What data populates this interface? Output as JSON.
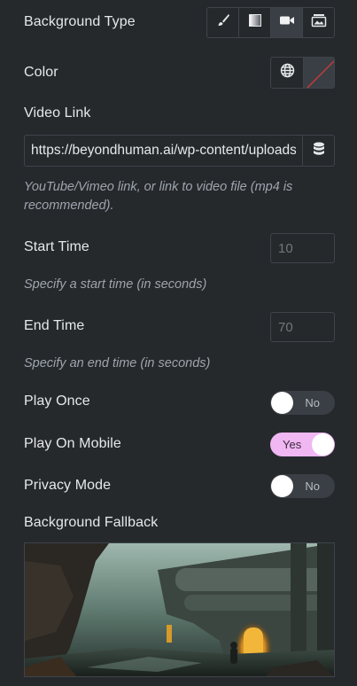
{
  "background_type": {
    "label": "Background Type",
    "options": [
      {
        "name": "classic",
        "icon": "brush-icon"
      },
      {
        "name": "gradient",
        "icon": "gradient-icon"
      },
      {
        "name": "video",
        "icon": "video-camera-icon",
        "active": true
      },
      {
        "name": "slideshow",
        "icon": "slideshow-icon"
      }
    ]
  },
  "color": {
    "label": "Color",
    "global_icon": "globe-icon",
    "value": "none"
  },
  "video_link": {
    "label": "Video Link",
    "value": "https://beyondhuman.ai/wp-content/uploads",
    "help": "YouTube/Vimeo link, or link to video file (mp4 is recommended).",
    "dynamic_icon": "database-icon"
  },
  "start_time": {
    "label": "Start Time",
    "placeholder": "10",
    "help": "Specify a start time (in seconds)"
  },
  "end_time": {
    "label": "End Time",
    "placeholder": "70",
    "help": "Specify an end time (in seconds)"
  },
  "play_once": {
    "label": "Play Once",
    "state": "No",
    "on": false
  },
  "play_on_mobile": {
    "label": "Play On Mobile",
    "state": "Yes",
    "on": true
  },
  "privacy_mode": {
    "label": "Privacy Mode",
    "state": "No",
    "on": false
  },
  "background_fallback": {
    "label": "Background Fallback"
  },
  "colors": {
    "panel": "#26292c",
    "border": "#3f444b",
    "toggle_on": "#f0b7f3"
  }
}
